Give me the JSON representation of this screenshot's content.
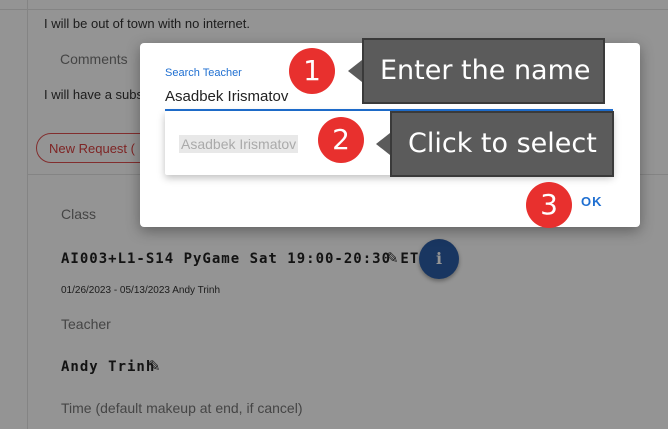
{
  "page": {
    "note_text": "I will be out of town with no internet.",
    "comments_label": "Comments",
    "comment_text": "I will have a subst",
    "new_request_label": "New Request (",
    "class_label": "Class",
    "class_value": "AI003+L1-S14 PyGame Sat 19:00-20:30 ET",
    "class_dates": "01/26/2023 - 05/13/2023 Andy Trinh",
    "teacher_label": "Teacher",
    "teacher_value": "Andy Trinh",
    "time_label": "Time (default makeup at end, if cancel)"
  },
  "dialog": {
    "search_label": "Search Teacher",
    "search_value": "Asadbek Irismatov",
    "option_label": "Asadbek Irismatov",
    "ok_label": "OK"
  },
  "annotations": {
    "step1_number": "1",
    "step1_text": "Enter the name",
    "step2_number": "2",
    "step2_text": "Click to select",
    "step3_number": "3"
  },
  "icons": {
    "edit": "pencil-icon",
    "info": "info-icon",
    "caret": "caret-up-icon"
  },
  "colors": {
    "accent_blue": "#1f6fd1",
    "info_button": "#2b5ea8",
    "badge_red": "#e8302e",
    "callout_gray": "#5b5b5b",
    "new_request_red": "#d94040"
  }
}
